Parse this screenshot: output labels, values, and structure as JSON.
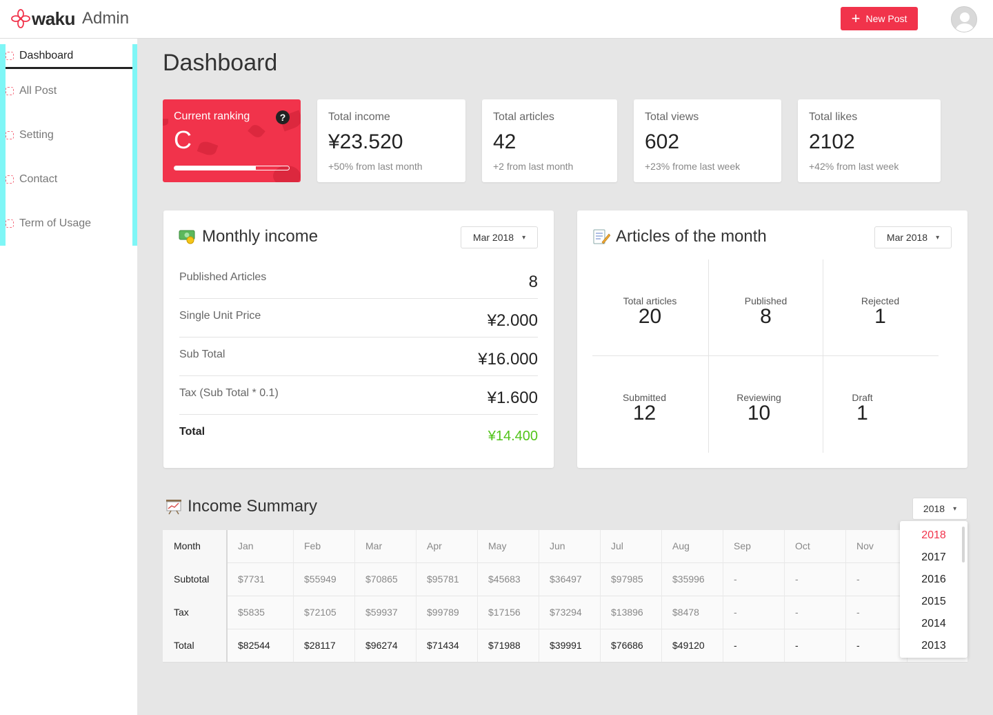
{
  "header": {
    "logo_text": "waku",
    "logo_sub": "Admin",
    "new_post_label": "New Post",
    "accent": "#f1334b"
  },
  "sidebar": {
    "items": [
      {
        "label": "Dashboard",
        "active": true
      },
      {
        "label": "All Post"
      },
      {
        "label": "Setting"
      },
      {
        "label": "Contact"
      },
      {
        "label": "Term of Usage"
      }
    ]
  },
  "page": {
    "title": "Dashboard"
  },
  "ranking": {
    "label": "Current ranking",
    "value": "C",
    "help": "?",
    "progress": 0.71
  },
  "stats": [
    {
      "label": "Total income",
      "value": "¥23.520",
      "sub": "+50% from last month"
    },
    {
      "label": "Total articles",
      "value": "42",
      "sub": "+2 from last month"
    },
    {
      "label": "Total views",
      "value": "602",
      "sub": "+23% frome last week"
    },
    {
      "label": "Total likes",
      "value": "2102",
      "sub": "+42% from last week"
    }
  ],
  "monthly_income": {
    "title": "Monthly income",
    "select": "Mar 2018",
    "rows": [
      {
        "key": "Published Articles",
        "value": "8"
      },
      {
        "key": "Single Unit Price",
        "value": "¥2.000"
      },
      {
        "key": "Sub Total",
        "value": "¥16.000"
      },
      {
        "key": "Tax (Sub Total * 0.1)",
        "value": "¥1.600"
      },
      {
        "key": "Total",
        "value": "¥14.400"
      }
    ],
    "total_color": "#52c41a"
  },
  "articles": {
    "title": "Articles of the month",
    "select": "Mar 2018",
    "cells": [
      {
        "key": "Total articles",
        "value": "20"
      },
      {
        "key": "Published",
        "value": "8"
      },
      {
        "key": "Rejected",
        "value": "1"
      },
      {
        "key": "Submitted",
        "value": "12"
      },
      {
        "key": "Reviewing",
        "value": "10"
      },
      {
        "key": "Draft",
        "value": "1"
      }
    ]
  },
  "summary": {
    "title": "Income Summary",
    "select": "2018",
    "header": [
      "Month",
      "Jan",
      "Feb",
      "Mar",
      "Apr",
      "May",
      "Jun",
      "Jul",
      "Aug",
      "Sep",
      "Oct",
      "Nov"
    ],
    "rows": [
      {
        "label": "Subtotal",
        "values": [
          "$7731",
          "$55949",
          "$70865",
          "$95781",
          "$45683",
          "$36497",
          "$97985",
          "$35996",
          "-",
          "-",
          "-"
        ]
      },
      {
        "label": "Tax",
        "values": [
          "$5835",
          "$72105",
          "$59937",
          "$99789",
          "$17156",
          "$73294",
          "$13896",
          "$8478",
          "-",
          "-",
          "-"
        ]
      },
      {
        "label": "Total",
        "values": [
          "$82544",
          "$28117",
          "$96274",
          "$71434",
          "$71988",
          "$39991",
          "$76686",
          "$49120",
          "-",
          "-",
          "-"
        ]
      }
    ],
    "year_options": [
      "2018",
      "2017",
      "2016",
      "2015",
      "2014",
      "2013"
    ],
    "selected_year": "2018"
  }
}
